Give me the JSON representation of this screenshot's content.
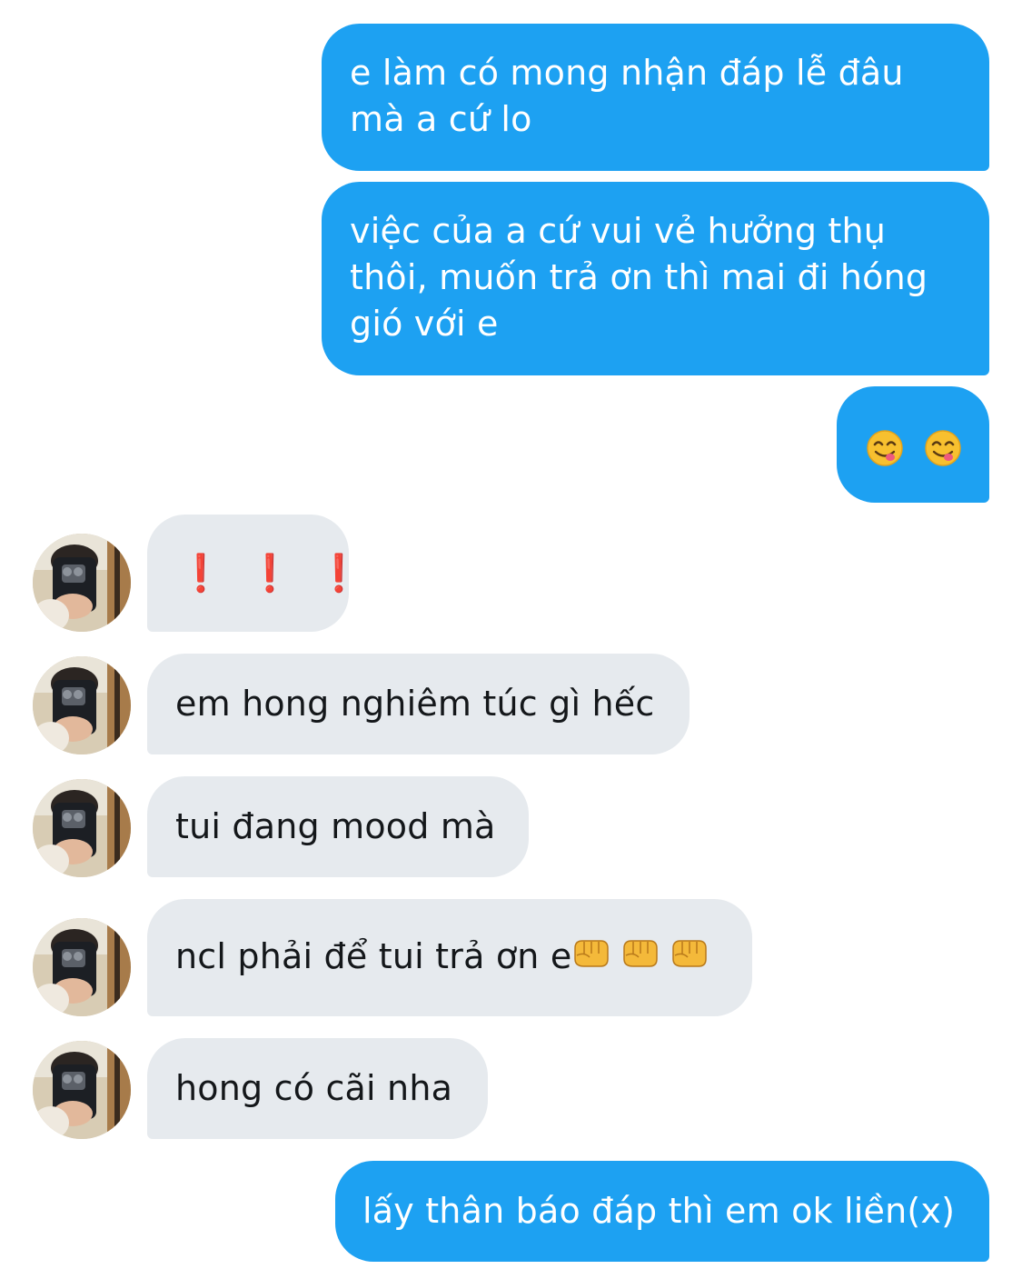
{
  "conversation": {
    "messages": [
      {
        "sender": "me",
        "lines": [
          "e làm có mong nhận đáp lễ đâu",
          "mà a cứ lo"
        ]
      },
      {
        "sender": "me",
        "lines": [
          "việc của a cứ vui vẻ hưởng thụ",
          "thôi, muốn trả ơn thì mai đi hóng",
          "gió với e"
        ]
      },
      {
        "sender": "me",
        "emoji": [
          "face-savoring-food-icon",
          "face-savoring-food-icon"
        ]
      },
      {
        "sender": "them",
        "text": "❗ ❗ ❗"
      },
      {
        "sender": "them",
        "text": "em hong nghiêm túc gì hếc"
      },
      {
        "sender": "them",
        "text": "tui đang mood mà"
      },
      {
        "sender": "them",
        "text": "ncl phải để tui trả ơn e",
        "emoji": [
          "fist-icon",
          "fist-icon",
          "fist-icon"
        ]
      },
      {
        "sender": "them",
        "text": "hong có cãi nha"
      },
      {
        "sender": "me",
        "text": "lấy thân báo đáp thì em ok liền(x)"
      }
    ]
  },
  "colors": {
    "outgoing_bubble": "#1DA1F2",
    "incoming_bubble": "#E6EAEE",
    "outgoing_text": "#FFFFFF",
    "incoming_text": "#14171A",
    "exclamation": "#D92B2B"
  },
  "icons": {
    "avatar": "user-avatar-photo",
    "savoring_face": "face-savoring-food-icon",
    "fist": "fist-icon"
  }
}
